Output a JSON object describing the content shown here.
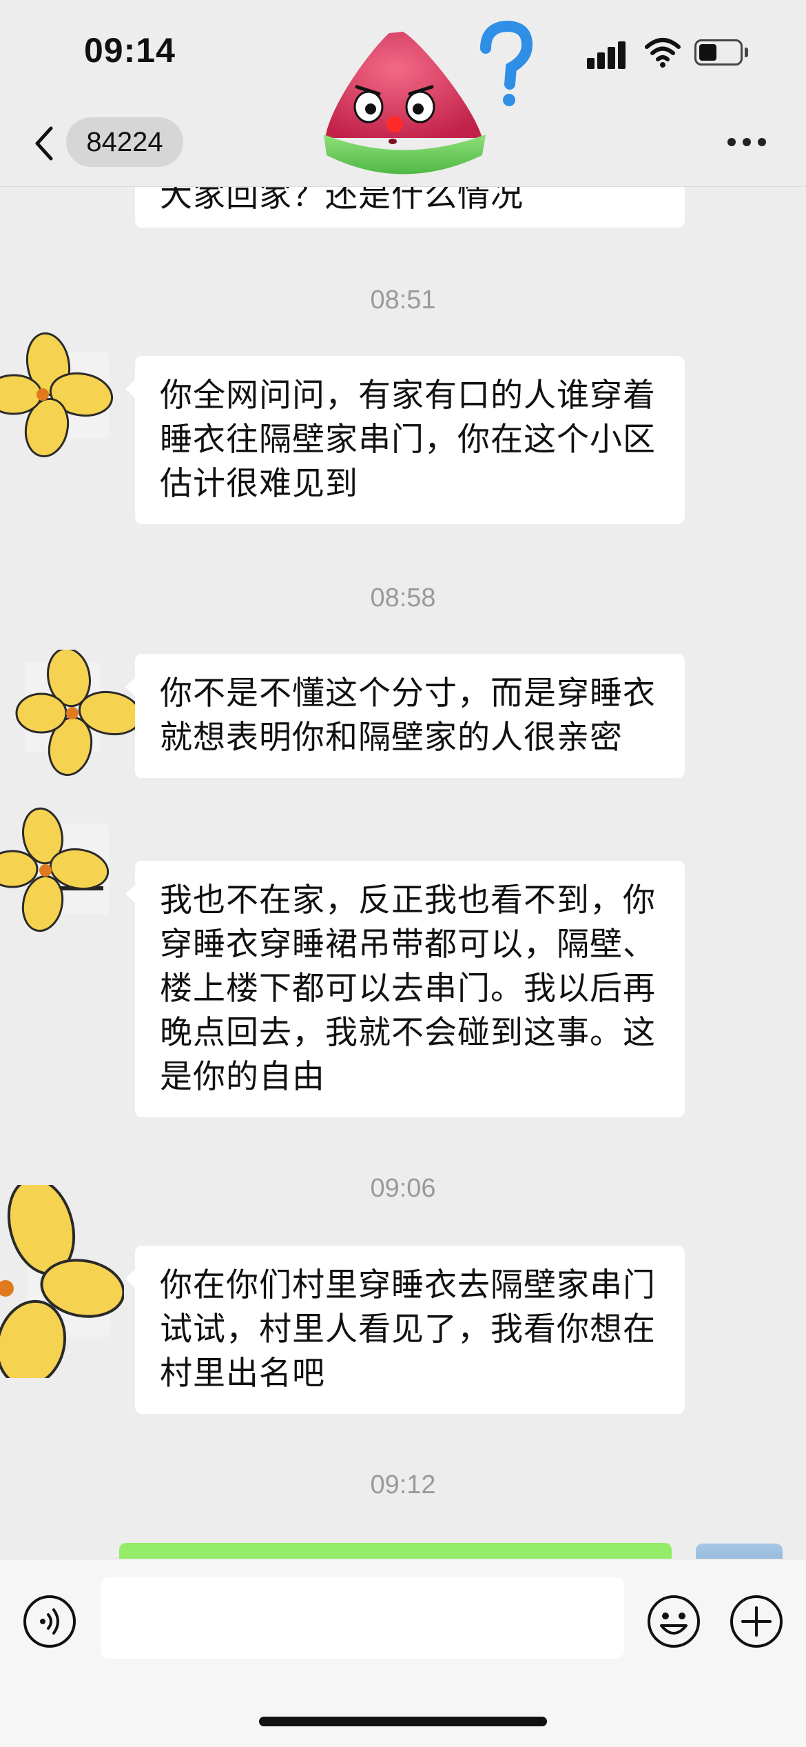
{
  "status_bar": {
    "time": "09:14",
    "battery_level": 0.45
  },
  "header": {
    "title": "84224"
  },
  "messages": [
    {
      "type": "received",
      "text": "大家回家？还是什么情况",
      "partial": true
    },
    {
      "type": "time",
      "text": "08:51"
    },
    {
      "type": "received",
      "text": "你全网问问，有家有口的人谁穿着睡衣往隔壁家串门，你在这个小区估计很难见到"
    },
    {
      "type": "time",
      "text": "08:58"
    },
    {
      "type": "received",
      "text": "你不是不懂这个分寸，而是穿睡衣就想表明你和隔壁家的人很亲密"
    },
    {
      "type": "received",
      "text": "我也不在家，反正我也看不到，你穿睡衣穿睡裙吊带都可以，隔壁、楼上楼下都可以去串门。我以后再晚点回去，我就不会碰到这事。这是你的自由"
    },
    {
      "type": "time",
      "text": "09:06"
    },
    {
      "type": "received",
      "text": "你在你们村里穿睡衣去隔壁家串门试试，村里人看见了，我看你想在村里出名吧"
    },
    {
      "type": "time",
      "text": "09:12"
    },
    {
      "type": "sent",
      "text": ""
    }
  ],
  "input": {
    "value": "",
    "placeholder": ""
  },
  "icons": {
    "back": "chevron-left-icon",
    "more": "more-dots-icon",
    "voice": "voice-icon",
    "emoji": "emoji-icon",
    "plus": "plus-icon"
  },
  "colors": {
    "background": "#ededed",
    "bubble_received": "#ffffff",
    "bubble_sent": "#95ec69",
    "timestamp": "#9a9a9a"
  }
}
